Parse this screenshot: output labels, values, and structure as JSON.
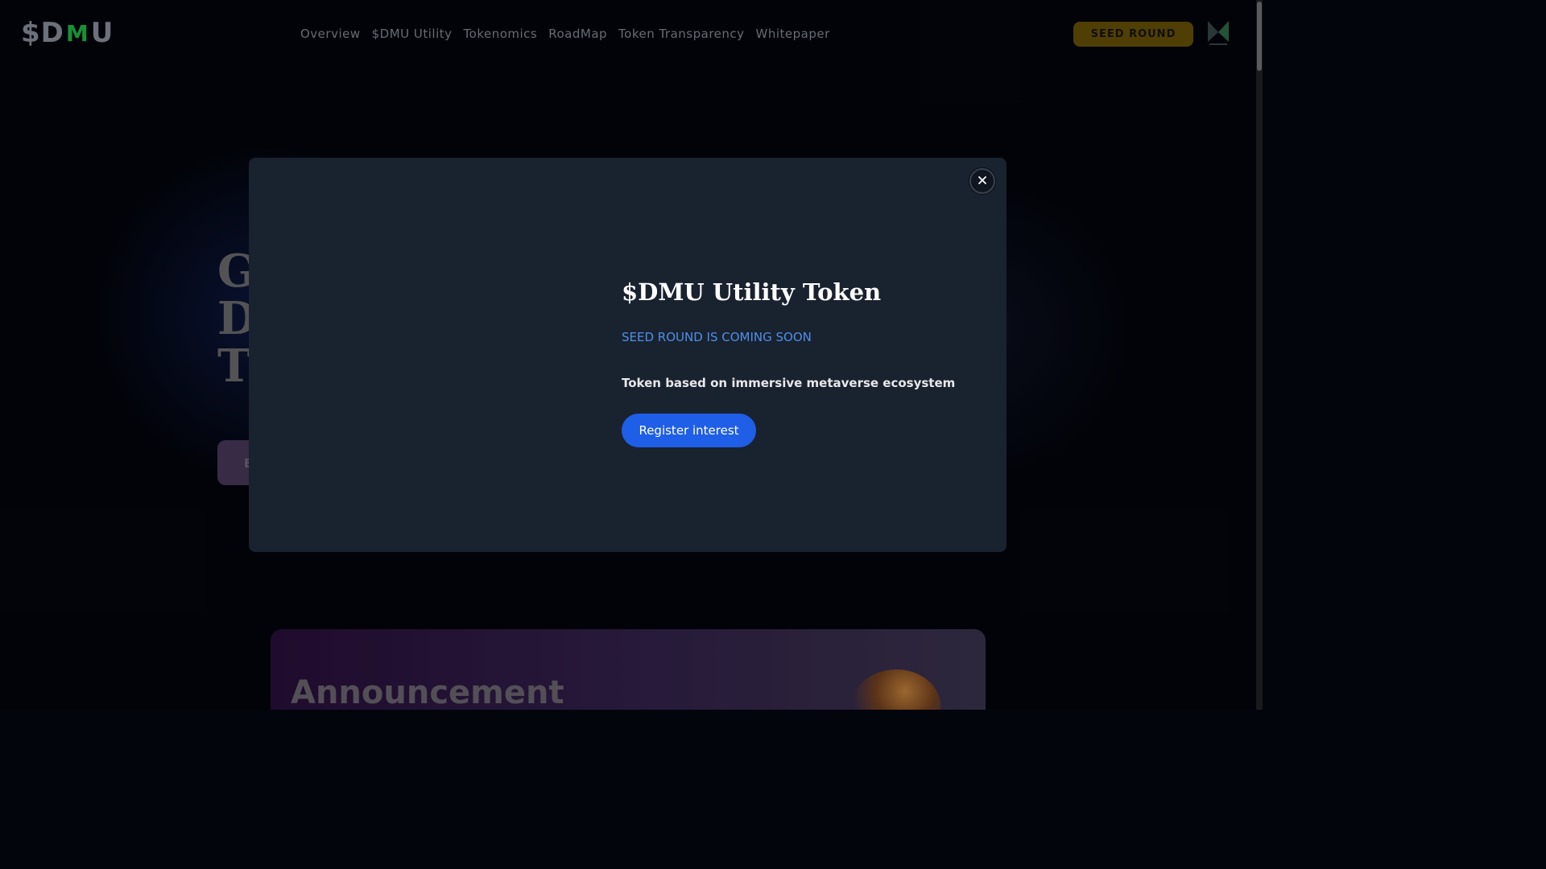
{
  "header": {
    "logo": {
      "part_a": "$D",
      "part_m": "M",
      "part_b": "U"
    },
    "nav": [
      {
        "label": "Overview"
      },
      {
        "label": "$DMU Utility"
      },
      {
        "label": "Tokenomics"
      },
      {
        "label": "RoadMap"
      },
      {
        "label": "Token Transparency"
      },
      {
        "label": "Whitepaper"
      }
    ],
    "seed_button": "SEED ROUND",
    "brand_icon": "metaverse-brand-icon"
  },
  "hero": {
    "title_lines": [
      "G",
      "D",
      "T"
    ],
    "button_partial": "E"
  },
  "modal": {
    "title": "$DMU Utility Token",
    "subtitle": "SEED ROUND IS COMING SOON",
    "description": "Token based on immersive metaverse ecosystem",
    "register_button": "Register interest",
    "close_icon": "close-icon"
  },
  "announcement": {
    "title": "Announcement"
  },
  "colors": {
    "background": "#03050d",
    "modal_bg": "#19222f",
    "accent_blue": "#1f5ee6",
    "subtitle_blue": "#4f8fe8",
    "seed_gold": "#6b5407",
    "logo_green": "#22c04a"
  }
}
